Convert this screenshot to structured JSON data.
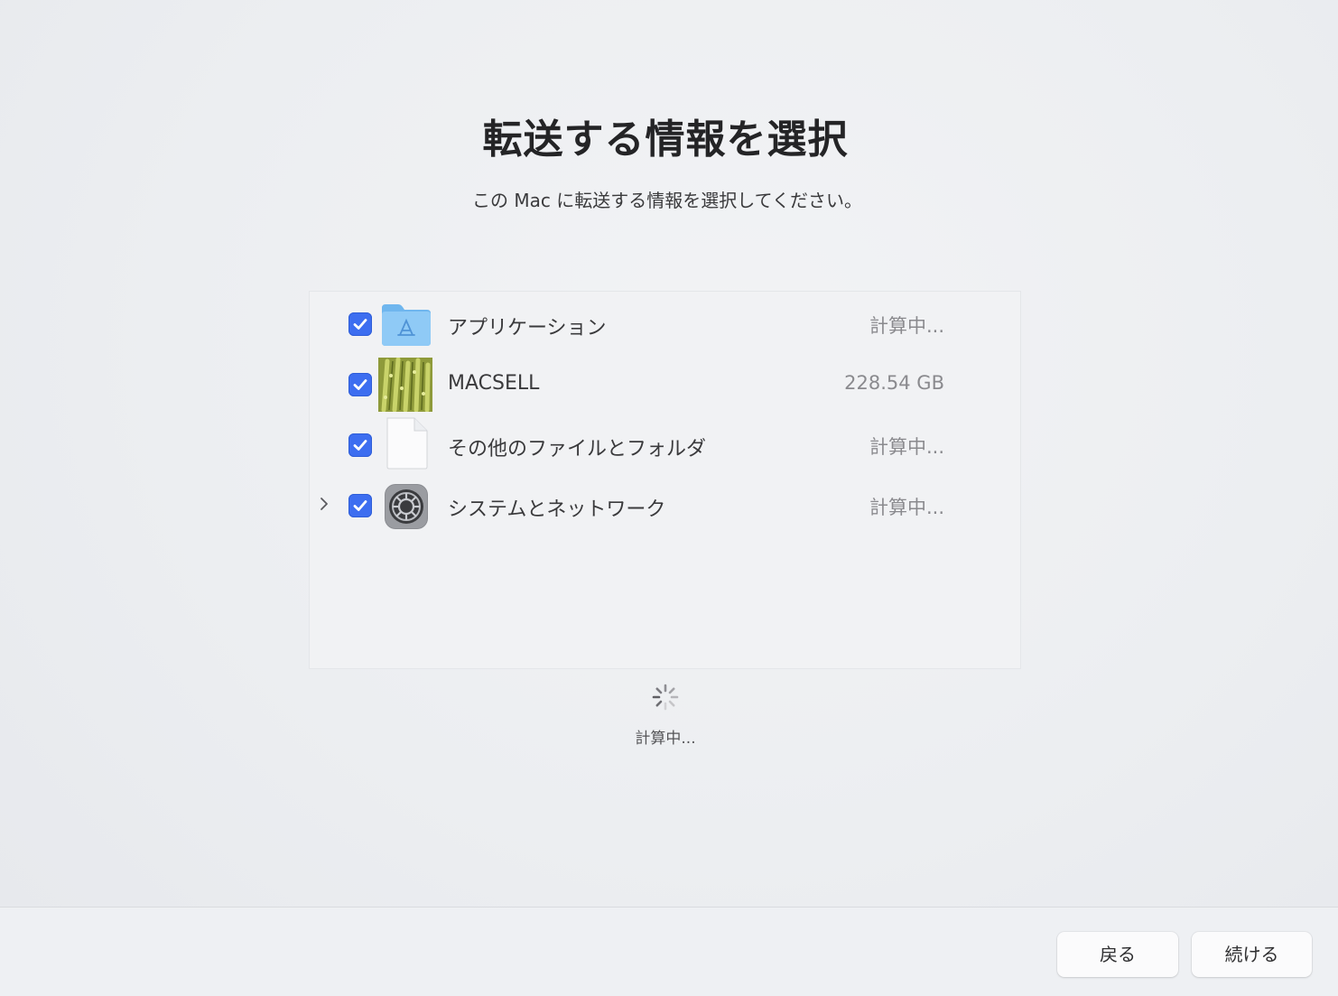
{
  "header": {
    "title": "転送する情報を選択",
    "subtitle": "この Mac に転送する情報を選択してください。"
  },
  "items": [
    {
      "label": "アプリケーション",
      "size": "計算中...",
      "checked": true,
      "icon": "applications-folder-icon",
      "expandable": false
    },
    {
      "label": "MACSELL",
      "size": "228.54 GB",
      "checked": true,
      "icon": "user-photo-icon",
      "expandable": false
    },
    {
      "label": "その他のファイルとフォルダ",
      "size": "計算中...",
      "checked": true,
      "icon": "document-icon",
      "expandable": false
    },
    {
      "label": "システムとネットワーク",
      "size": "計算中...",
      "checked": true,
      "icon": "system-settings-icon",
      "expandable": true
    }
  ],
  "status": {
    "text": "計算中..."
  },
  "buttons": {
    "back": "戻る",
    "continue": "続ける"
  },
  "colors": {
    "checkbox": "#3d6ef0",
    "folder": "#7ec0f2"
  }
}
